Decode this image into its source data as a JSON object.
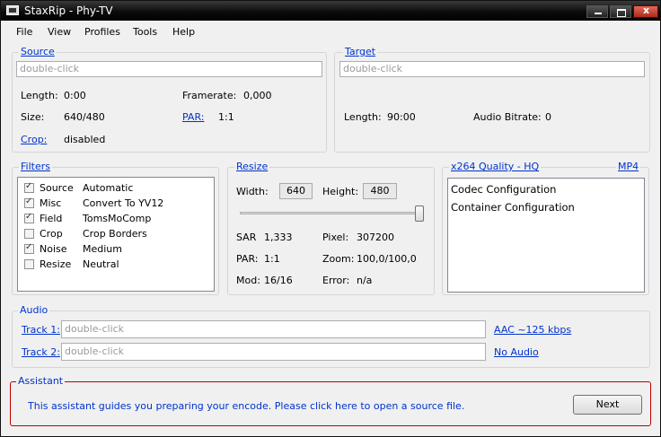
{
  "window": {
    "title": "StaxRip - Phy-TV"
  },
  "menu": [
    "File",
    "View",
    "Profiles",
    "Tools",
    "Help"
  ],
  "source": {
    "title": "Source",
    "input_placeholder": "double-click",
    "length_label": "Length:",
    "length_value": "0:00",
    "framerate_label": "Framerate:",
    "framerate_value": "0,000",
    "size_label": "Size:",
    "size_value": "640/480",
    "par_label": "PAR:",
    "par_value": "1:1",
    "crop_label": "Crop:",
    "crop_value": "disabled"
  },
  "target": {
    "title": "Target",
    "input_placeholder": "double-click",
    "length_label": "Length:",
    "length_value": "90:00",
    "bitrate_label": "Audio Bitrate:",
    "bitrate_value": "0"
  },
  "filters": {
    "title": "Filters",
    "items": [
      {
        "category": "Source",
        "name": "Automatic",
        "checked": true
      },
      {
        "category": "Misc",
        "name": "Convert To YV12",
        "checked": true
      },
      {
        "category": "Field",
        "name": "TomsMoComp",
        "checked": true
      },
      {
        "category": "Crop",
        "name": "Crop Borders",
        "checked": false
      },
      {
        "category": "Noise",
        "name": "Medium",
        "checked": true
      },
      {
        "category": "Resize",
        "name": "Neutral",
        "checked": false
      }
    ]
  },
  "resize": {
    "title": "Resize",
    "width_label": "Width:",
    "width_value": "640",
    "height_label": "Height:",
    "height_value": "480",
    "slider_fraction": 1.0,
    "sar_label": "SAR",
    "sar_value": "1,333",
    "pixel_label": "Pixel:",
    "pixel_value": "307200",
    "par_label": "PAR:",
    "par_value": "1:1",
    "zoom_label": "Zoom:",
    "zoom_value": "100,0/100,0",
    "mod_label": "Mod:",
    "mod_value": "16/16",
    "error_label": "Error:",
    "error_value": "n/a"
  },
  "encoder": {
    "title": "x264 Quality - HQ",
    "container": "MP4",
    "items": [
      "Codec Configuration",
      "Container Configuration"
    ]
  },
  "audio": {
    "title": "Audio",
    "track1_label": "Track 1:",
    "track1_placeholder": "double-click",
    "track1_profile": "AAC ~125 kbps",
    "track2_label": "Track 2:",
    "track2_placeholder": "double-click",
    "track2_profile": "No Audio"
  },
  "assistant": {
    "title": "Assistant",
    "message": "This assistant guides you preparing your encode. Please click here to open a source file.",
    "next_label": "Next"
  }
}
